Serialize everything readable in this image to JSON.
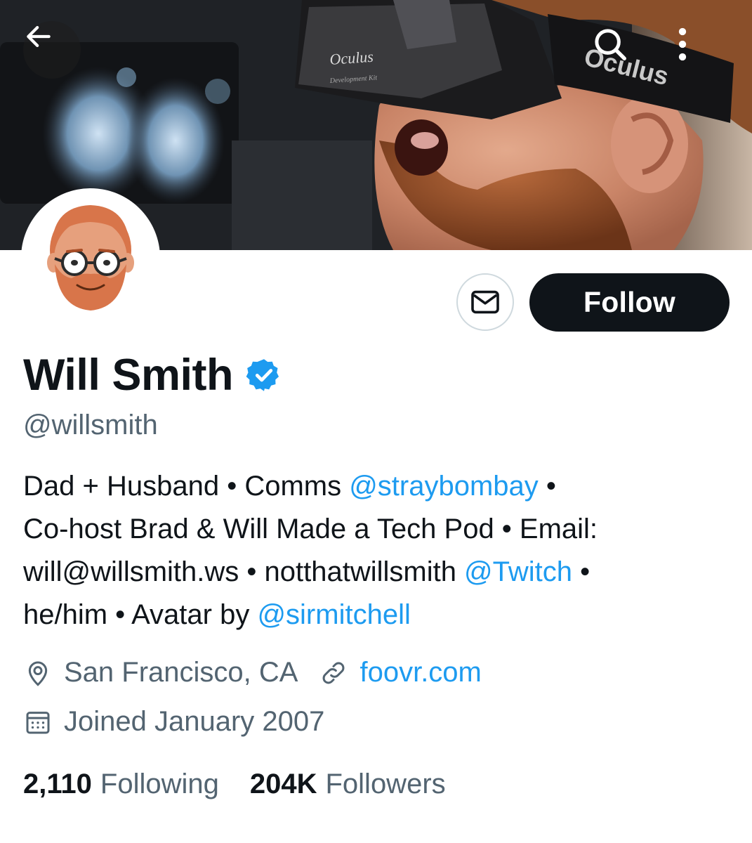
{
  "banner": {
    "headset_brand": "Oculus",
    "headset_subtitle": "Development Kit",
    "strap_text": "Oculus"
  },
  "toolbar": {
    "back_icon": "arrow-left-icon",
    "search_icon": "search-icon",
    "more_icon": "more-vertical-icon"
  },
  "actions": {
    "message_icon": "mail-icon",
    "follow_label": "Follow"
  },
  "profile": {
    "name": "Will Smith",
    "verified_icon": "verified-badge-icon",
    "handle": "@willsmith",
    "bio": {
      "l1_a": "Dad + Husband • Comms ",
      "l1_link": "@straybombay",
      "l1_b": " •",
      "l2": "Co-host Brad & Will Made a Tech Pod • Email:",
      "l3_a": "will@willsmith.ws • notthatwillsmith ",
      "l3_link": "@Twitch",
      "l3_b": " •",
      "l4_a": "he/him • Avatar by ",
      "l4_link": "@sirmitchell"
    },
    "location": "San Francisco, CA",
    "website": "foovr.com",
    "joined": "Joined January 2007"
  },
  "stats": {
    "following_count": "2,110",
    "following_label": "Following",
    "followers_count": "204K",
    "followers_label": "Followers"
  },
  "colors": {
    "link": "#1d9bf0",
    "secondary_text": "#536471",
    "primary_text": "#0f1419",
    "follow_bg": "#0f1419"
  }
}
